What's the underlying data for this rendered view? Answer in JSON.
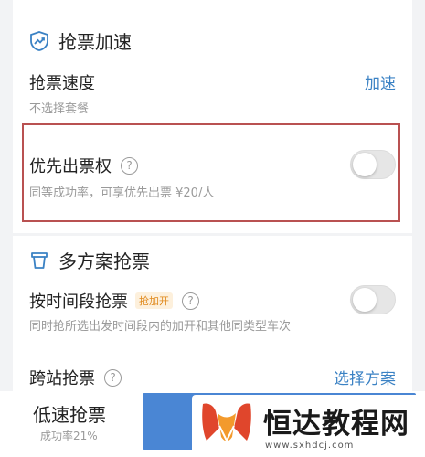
{
  "accelerate": {
    "title": "抢票加速",
    "speed_label": "抢票速度",
    "speed_sub": "不选择套餐",
    "speed_link": "加速",
    "priority_label": "优先出票权",
    "priority_sub": "同等成功率，可享优先出票 ¥20/人",
    "priority_enabled": false
  },
  "multi_plan": {
    "title": "多方案抢票",
    "time_label": "按时间段抢票",
    "time_badge": "抢加开",
    "time_sub": "同时抢所选出发时间段内的加开和其他同类型车次",
    "time_enabled": false,
    "station_label": "跨站抢票",
    "station_link": "选择方案"
  },
  "bottom": {
    "slow_label": "低速抢票",
    "slow_sub": "成功率21%"
  },
  "watermark": {
    "name": "恒达教程网",
    "url": "www.sxhdcj.com"
  },
  "colors": {
    "accent": "#3b82c4",
    "primary_button": "#4a86d4",
    "highlight_border": "#b95151",
    "badge": "#e08a1e"
  },
  "icons": [
    "shield-chart-icon",
    "cup-icon",
    "help-icon",
    "watermark-logo-icon"
  ]
}
